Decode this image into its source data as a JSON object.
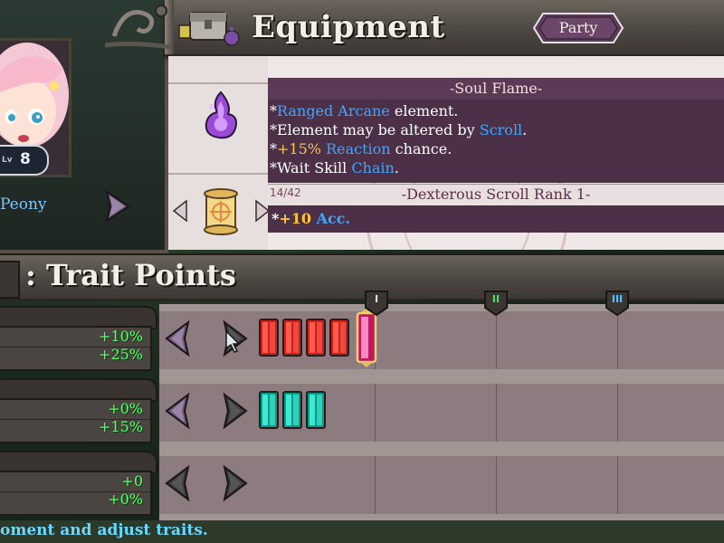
{
  "header": {
    "title": "Equipment",
    "party_label": "Party"
  },
  "character": {
    "name": "Peony",
    "level_prefix": "Lv",
    "level": "8"
  },
  "item": {
    "name": "-Soul Flame-",
    "description": [
      [
        {
          "t": "*",
          "c": "w"
        },
        {
          "t": "Ranged Arcane",
          "c": "b"
        },
        {
          "t": " element.",
          "c": "w"
        }
      ],
      [
        {
          "t": "*Element may be altered by ",
          "c": "w"
        },
        {
          "t": "Scroll",
          "c": "b"
        },
        {
          "t": ".",
          "c": "w"
        }
      ],
      [
        {
          "t": "*",
          "c": "w"
        },
        {
          "t": "+15%",
          "c": "y"
        },
        {
          "t": " ",
          "c": "w"
        },
        {
          "t": "Reaction",
          "c": "b"
        },
        {
          "t": " chance.",
          "c": "w"
        }
      ],
      [
        {
          "t": "*Wait Skill ",
          "c": "w"
        },
        {
          "t": "Chain",
          "c": "b"
        },
        {
          "t": ".",
          "c": "w"
        }
      ]
    ],
    "scroll_count": "14/42",
    "scroll_name": "-Dexterous Scroll Rank 1-",
    "scroll_bonus_star": "*",
    "scroll_bonus_value": "+10",
    "scroll_bonus_stat": "Acc."
  },
  "traits": {
    "title": ": Trait Points",
    "tiers": [
      "I",
      "II",
      "III"
    ],
    "tier_colors": [
      "#e9e4dc",
      "#4be06a",
      "#4fc3ff"
    ],
    "rows": [
      {
        "values": [
          "+10%",
          "+25%"
        ],
        "gems_filled": 4,
        "gem_color": "red",
        "current_gem": true
      },
      {
        "values": [
          "+0%",
          "+15%"
        ],
        "gems_filled": 3,
        "gem_color": "teal",
        "current_gem": false
      },
      {
        "values": [
          "+0",
          "+0%"
        ],
        "gems_filled": 0,
        "gem_color": "none",
        "current_gem": false
      }
    ]
  },
  "footer": {
    "hint": "oment and adjust traits."
  },
  "colors": {
    "accent_blue": "#3ea6ff",
    "accent_yellow": "#ffc43d",
    "stat_green": "#5dff70",
    "panel_purple": "#4b3048"
  }
}
